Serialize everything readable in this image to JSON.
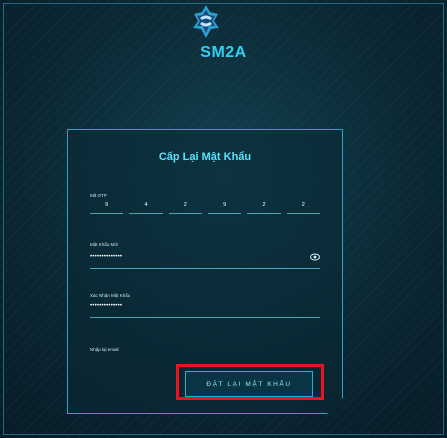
{
  "brand": "SM2A",
  "form": {
    "title": "Cấp Lại Mật Khẩu",
    "otp_label": "Mã OTP",
    "otp_digits": [
      "9",
      "4",
      "2",
      "9",
      "2",
      "2"
    ],
    "new_password_label": "Mật Khẩu Mới",
    "new_password_value": "••••••••••••••",
    "confirm_password_label": "Xác Nhận Mật Khẩu",
    "confirm_password_value": "••••••••••••••",
    "email_label": "Nhập lại email",
    "submit_label": "ĐẶT LẠI MẬT KHẨU"
  },
  "icons": {
    "logo": "sm2a-logo-icon",
    "eye": "eye-icon"
  },
  "colors": {
    "accent": "#2fd1f2",
    "highlight": "#e8141e",
    "background": "#0b2a38"
  }
}
